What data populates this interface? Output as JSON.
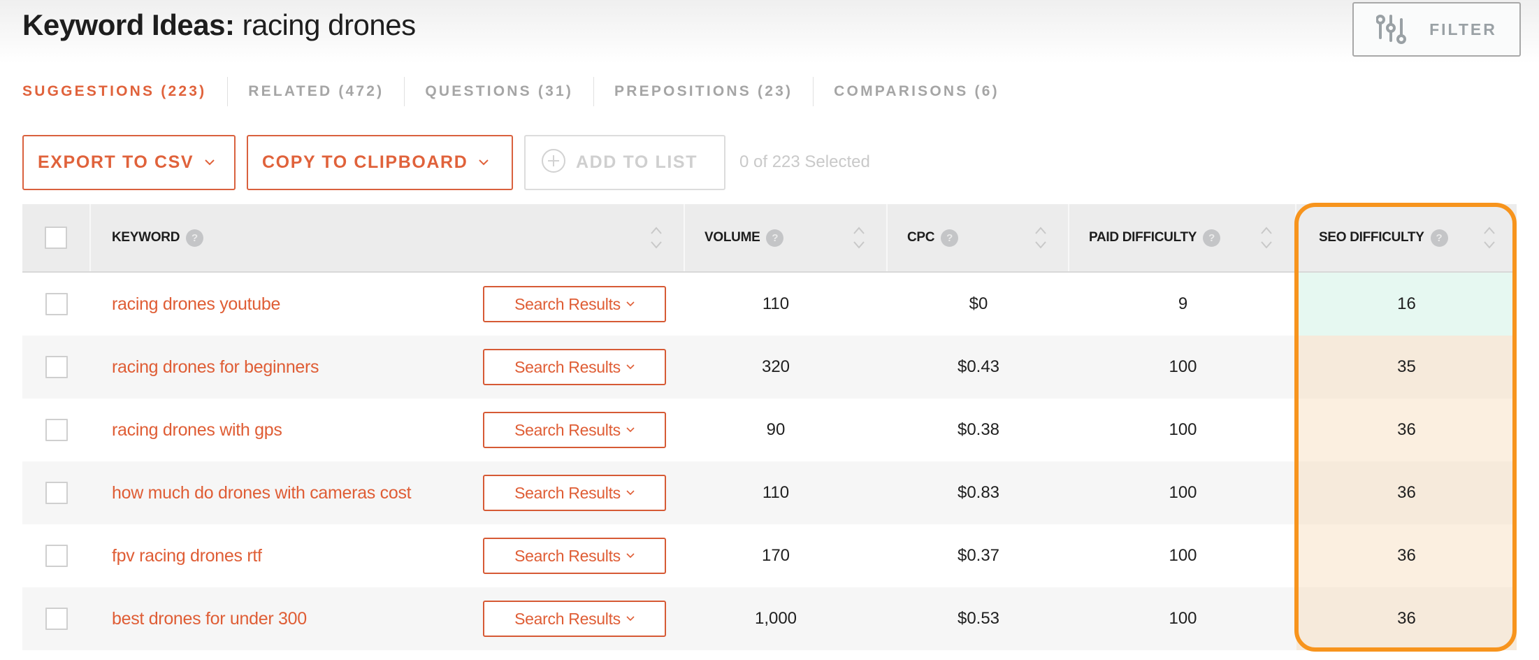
{
  "header": {
    "title_prefix": "Keyword Ideas:",
    "title_query": "racing drones",
    "filter_label": "FILTER",
    "filter_icon": "sliders-icon"
  },
  "tabs": [
    {
      "label": "SUGGESTIONS (223)",
      "active": true
    },
    {
      "label": "RELATED (472)",
      "active": false
    },
    {
      "label": "QUESTIONS (31)",
      "active": false
    },
    {
      "label": "PREPOSITIONS (23)",
      "active": false
    },
    {
      "label": "COMPARISONS (6)",
      "active": false
    }
  ],
  "toolbar": {
    "export_label": "EXPORT TO CSV",
    "copy_label": "COPY TO CLIPBOARD",
    "add_label": "ADD TO LIST",
    "selected_text": "0 of 223 Selected"
  },
  "table": {
    "columns": {
      "keyword": "KEYWORD",
      "volume": "VOLUME",
      "cpc": "CPC",
      "paid_difficulty": "PAID DIFFICULTY",
      "seo_difficulty": "SEO DIFFICULTY"
    },
    "help_glyph": "?",
    "search_results_label": "Search Results",
    "rows": [
      {
        "keyword": "racing drones youtube",
        "volume": "110",
        "cpc": "$0",
        "paid_difficulty": "9",
        "seo_difficulty": "16",
        "seo_level": "easy"
      },
      {
        "keyword": "racing drones for beginners",
        "volume": "320",
        "cpc": "$0.43",
        "paid_difficulty": "100",
        "seo_difficulty": "35",
        "seo_level": "medium"
      },
      {
        "keyword": "racing drones with gps",
        "volume": "90",
        "cpc": "$0.38",
        "paid_difficulty": "100",
        "seo_difficulty": "36",
        "seo_level": "medium"
      },
      {
        "keyword": "how much do drones with cameras cost",
        "volume": "110",
        "cpc": "$0.83",
        "paid_difficulty": "100",
        "seo_difficulty": "36",
        "seo_level": "medium"
      },
      {
        "keyword": "fpv racing drones rtf",
        "volume": "170",
        "cpc": "$0.37",
        "paid_difficulty": "100",
        "seo_difficulty": "36",
        "seo_level": "medium"
      },
      {
        "keyword": "best drones for under 300",
        "volume": "1,000",
        "cpc": "$0.53",
        "paid_difficulty": "100",
        "seo_difficulty": "36",
        "seo_level": "medium"
      }
    ]
  },
  "colors": {
    "accent": "#e0623b",
    "highlight": "#f7941d",
    "seo_easy_bg": "#e6f8f1",
    "seo_medium_bg": "#fbefe0",
    "muted": "#a5a5a5"
  }
}
